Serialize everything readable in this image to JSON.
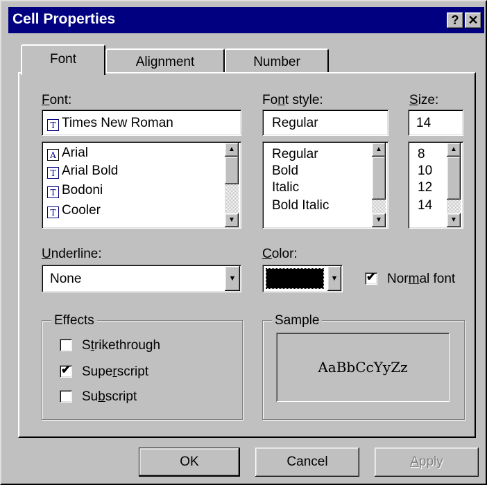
{
  "window": {
    "title": "Cell Properties",
    "help_glyph": "?",
    "close_glyph": "✕"
  },
  "tabs": [
    {
      "label": "Font",
      "active": true
    },
    {
      "label": "Alignment",
      "active": false
    },
    {
      "label": "Number",
      "active": false
    }
  ],
  "font": {
    "label_prefix": "",
    "label_accel": "F",
    "label_rest": "ont:",
    "value": "Times New Roman",
    "items": [
      {
        "label": "Arial",
        "icon": "printer-font-icon"
      },
      {
        "label": "Arial Bold",
        "icon": "truetype-font-icon"
      },
      {
        "label": "Bodoni",
        "icon": "truetype-font-icon"
      },
      {
        "label": "Cooler",
        "icon": "truetype-font-icon"
      }
    ],
    "value_icon": "truetype-font-icon"
  },
  "font_style": {
    "label_prefix": "Fo",
    "label_accel": "n",
    "label_rest": "t style:",
    "value": "Regular",
    "items": [
      "Regular",
      "Bold",
      "Italic",
      "Bold Italic"
    ]
  },
  "size": {
    "label_prefix": "",
    "label_accel": "S",
    "label_rest": "ize:",
    "value": "14",
    "items": [
      "8",
      "10",
      "12",
      "14"
    ]
  },
  "underline": {
    "label_prefix": "",
    "label_accel": "U",
    "label_rest": "nderline:",
    "value": "None"
  },
  "color": {
    "label_prefix": "",
    "label_accel": "C",
    "label_rest": "olor:",
    "swatch": "#000000"
  },
  "normal_font": {
    "checked": true,
    "label_prefix": "Nor",
    "label_accel": "m",
    "label_rest": "al font"
  },
  "effects": {
    "title": "Effects",
    "options": [
      {
        "prefix": "S",
        "accel": "t",
        "rest": "rikethrough",
        "checked": false
      },
      {
        "prefix": "Supe",
        "accel": "r",
        "rest": "script",
        "checked": true
      },
      {
        "prefix": "Su",
        "accel": "b",
        "rest": "script",
        "checked": false
      }
    ]
  },
  "sample": {
    "title": "Sample",
    "text": "AaBbCcYyZz"
  },
  "buttons": {
    "ok": "OK",
    "cancel": "Cancel",
    "apply": "Apply",
    "apply_accel": "A",
    "apply_rest": "pply"
  },
  "glyphs": {
    "check": "✔",
    "up": "▲",
    "down": "▼",
    "truetype": "T"
  }
}
